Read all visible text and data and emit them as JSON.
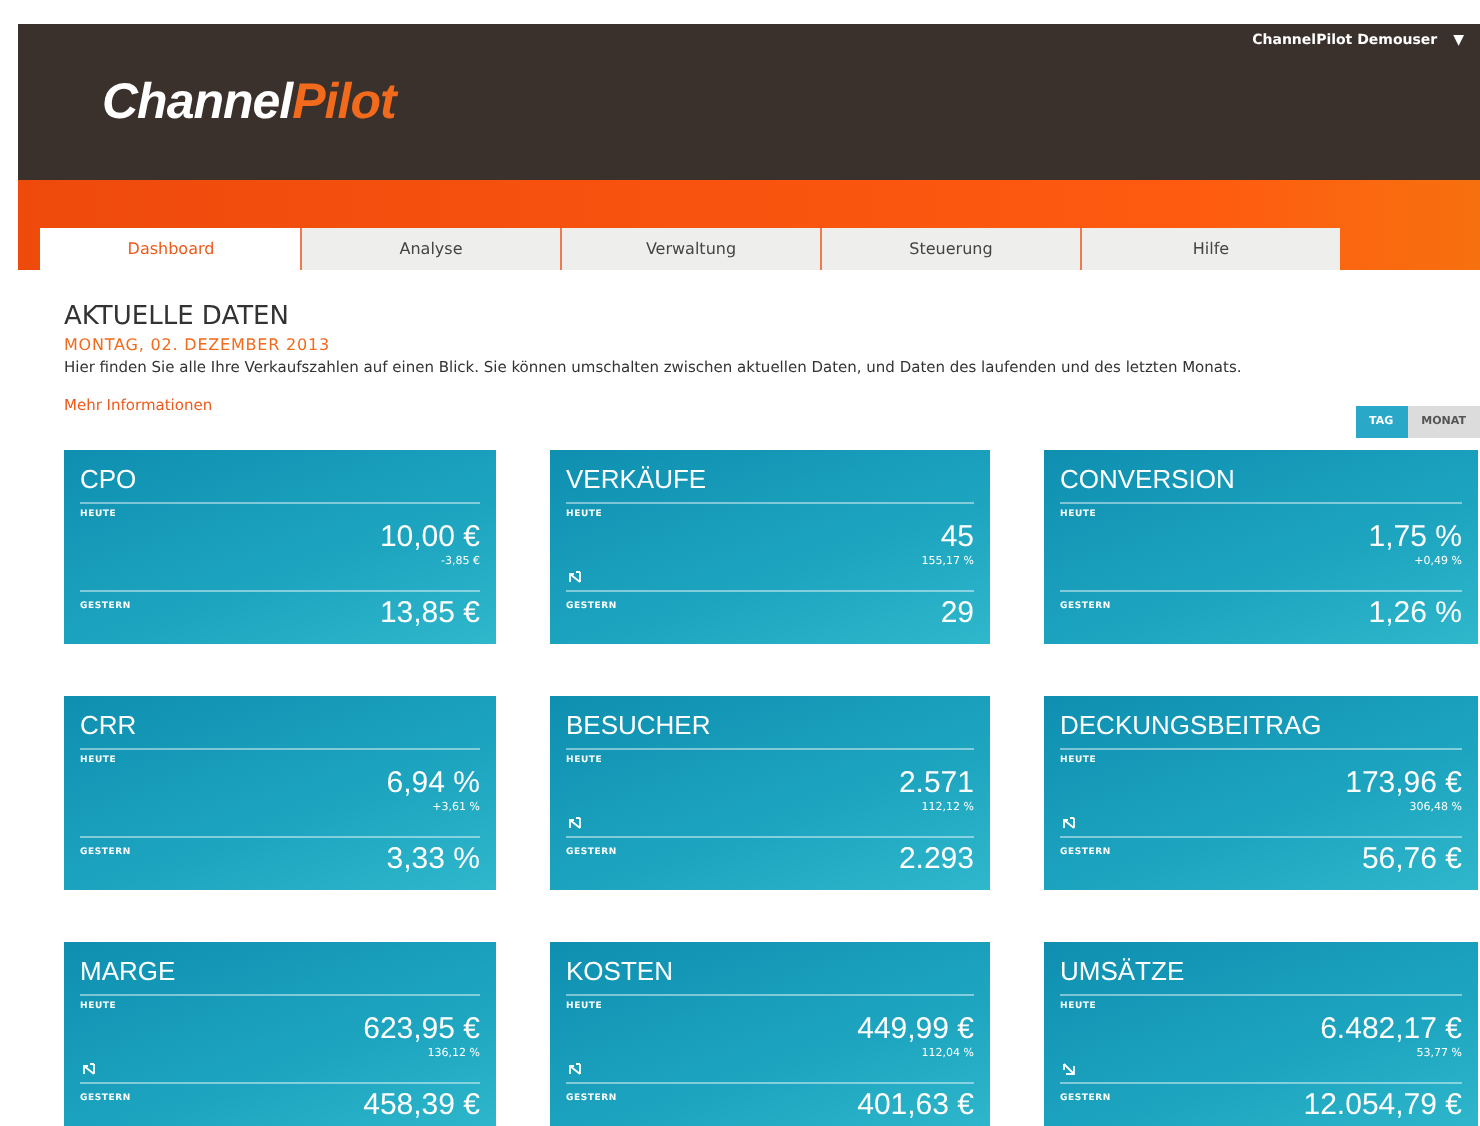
{
  "header": {
    "logo_first": "Channel",
    "logo_second": "Pilot",
    "user": "ChannelPilot Demouser",
    "user_menu_caret": "▼"
  },
  "tabs": [
    {
      "label": "Dashboard",
      "selected": true
    },
    {
      "label": "Analyse",
      "selected": false
    },
    {
      "label": "Verwaltung",
      "selected": false
    },
    {
      "label": "Steuerung",
      "selected": false
    },
    {
      "label": "Hilfe",
      "selected": false
    }
  ],
  "intro": {
    "title": "AKTUELLE DATEN",
    "date": "MONTAG, 02. DEZEMBER 2013",
    "text": "Hier finden Sie alle Ihre Verkaufszahlen auf einen Blick. Sie können umschalten zwischen aktuellen Daten, und Daten des laufenden und des letzten Monats.",
    "link": "Mehr Informationen"
  },
  "period_toggle": [
    {
      "label": "TAG",
      "selected": true
    },
    {
      "label": "MONAT",
      "selected": false
    }
  ],
  "cards": [
    {
      "title": "CPO",
      "today_label": "HEUTE",
      "today": "10,00 €",
      "delta": "-3,85 €",
      "kind": "plain",
      "yesterday_label": "GESTERN",
      "yesterday": "13,85 €"
    },
    {
      "title": "VERKÄUFE",
      "today_label": "HEUTE",
      "today": "45",
      "delta": "155,17 %",
      "kind": "rising",
      "yesterday_label": "GESTERN",
      "yesterday": "29"
    },
    {
      "title": "CONVERSION",
      "today_label": "HEUTE",
      "today": "1,75 %",
      "delta": "+0,49 %",
      "kind": "plain",
      "yesterday_label": "GESTERN",
      "yesterday": "1,26 %"
    },
    {
      "title": "CRR",
      "today_label": "HEUTE",
      "today": "6,94 %",
      "delta": "+3,61 %",
      "kind": "plain",
      "yesterday_label": "GESTERN",
      "yesterday": "3,33 %"
    },
    {
      "title": "BESUCHER",
      "today_label": "HEUTE",
      "today": "2.571",
      "delta": "112,12 %",
      "kind": "rising",
      "yesterday_label": "GESTERN",
      "yesterday": "2.293"
    },
    {
      "title": "DECKUNGSBEITRAG",
      "today_label": "HEUTE",
      "today": "173,96 €",
      "delta": "306,48 %",
      "kind": "rising",
      "yesterday_label": "GESTERN",
      "yesterday": "56,76 €"
    },
    {
      "title": "MARGE",
      "today_label": "HEUTE",
      "today": "623,95 €",
      "delta": "136,12 %",
      "kind": "rising",
      "yesterday_label": "GESTERN",
      "yesterday": "458,39 €"
    },
    {
      "title": "KOSTEN",
      "today_label": "HEUTE",
      "today": "449,99 €",
      "delta": "112,04 %",
      "kind": "rising",
      "yesterday_label": "GESTERN",
      "yesterday": "401,63 €"
    },
    {
      "title": "UMSÄTZE",
      "today_label": "HEUTE",
      "today": "6.482,17 €",
      "delta": "53,77 %",
      "kind": "falling",
      "yesterday_label": "GESTERN",
      "yesterday": "12.054,79 €"
    }
  ]
}
